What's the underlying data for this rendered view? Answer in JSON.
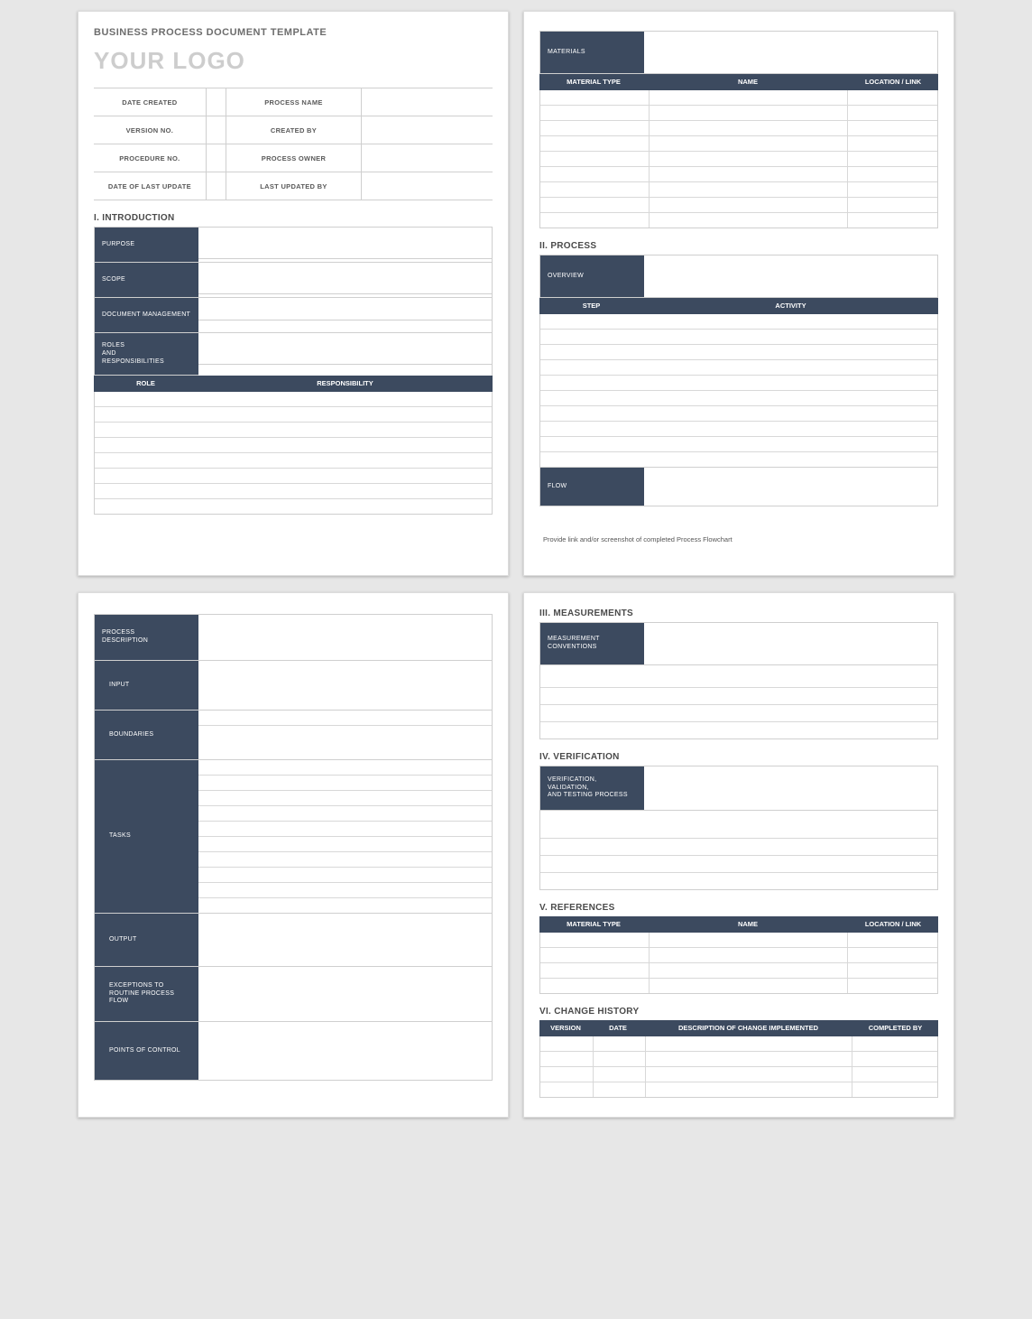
{
  "doc_title": "BUSINESS PROCESS DOCUMENT TEMPLATE",
  "logo_text": "YOUR LOGO",
  "meta": {
    "rows": [
      {
        "l": "DATE CREATED",
        "r": "PROCESS NAME"
      },
      {
        "l": "VERSION NO.",
        "r": "CREATED BY"
      },
      {
        "l": "PROCEDURE NO.",
        "r": "PROCESS OWNER"
      },
      {
        "l": "DATE OF LAST UPDATE",
        "r": "LAST UPDATED BY"
      }
    ]
  },
  "sections": {
    "intro_head": "I.   INTRODUCTION",
    "process_head": "II.  PROCESS",
    "measurements_head": "III.  MEASUREMENTS",
    "verification_head": "IV.  VERIFICATION",
    "references_head": "V.  REFERENCES",
    "change_head": "VI.  CHANGE HISTORY"
  },
  "labels": {
    "purpose": "PURPOSE",
    "scope": "SCOPE",
    "doc_mgmt": "DOCUMENT MANAGEMENT",
    "roles": "ROLES\nAND\nRESPONSIBILITIES",
    "role_col": "ROLE",
    "resp_col": "RESPONSIBILITY",
    "materials": "MATERIALS",
    "material_type": "MATERIAL TYPE",
    "name": "NAME",
    "location": "LOCATION / LINK",
    "overview": "OVERVIEW",
    "step": "STEP",
    "activity": "ACTIVITY",
    "flow": "FLOW",
    "flow_note": "Provide link and/or screenshot of completed Process Flowchart",
    "proc_desc": "PROCESS\nDESCRIPTION",
    "input": "INPUT",
    "boundaries": "BOUNDARIES",
    "tasks": "TASKS",
    "output": "OUTPUT",
    "exceptions": "EXCEPTIONS TO\nROUTINE PROCESS FLOW",
    "points": "POINTS OF CONTROL",
    "meas_conv": "MEASUREMENT\nCONVENTIONS",
    "vvtp": "VERIFICATION, VALIDATION,\nAND TESTING PROCESS",
    "version": "VERSION",
    "date": "DATE",
    "change_desc": "DESCRIPTION OF CHANGE IMPLEMENTED",
    "completed_by": "COMPLETED BY"
  }
}
